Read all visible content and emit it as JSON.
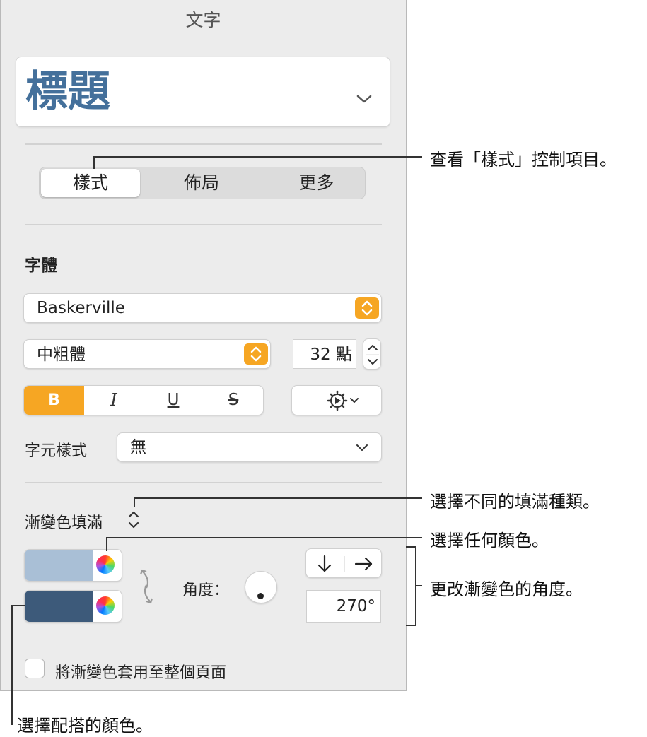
{
  "panel": {
    "title": "文字",
    "style_name": "標題",
    "tabs": [
      {
        "label": "樣式",
        "selected": true
      },
      {
        "label": "佈局",
        "selected": false
      },
      {
        "label": "更多",
        "selected": false
      }
    ],
    "font_section_title": "字體",
    "font_family": "Baskerville",
    "font_weight": "中粗體",
    "font_size": "32 點",
    "format_buttons": {
      "bold": "B",
      "italic": "I",
      "underline": "U",
      "strike": "S"
    },
    "char_style_label": "字元樣式",
    "char_style_value": "無",
    "fill_type_label": "漸變色填滿",
    "angle_label": "角度：",
    "angle_value": "270°",
    "apply_page_label": "將漸變色套用至整個頁面",
    "apply_page_checked": false,
    "colors": {
      "accent": "#f6a623",
      "title_blue": "#44709b",
      "gradient_top": "#a9bfd6",
      "gradient_bottom": "#3d5a7a"
    }
  },
  "annotations": {
    "style_controls": "查看「樣式」控制項目。",
    "fill_type": "選擇不同的填滿種類。",
    "any_color": "選擇任何顏色。",
    "angle": "更改漸變色的角度。",
    "matching_color": "選擇配搭的顏色。"
  }
}
